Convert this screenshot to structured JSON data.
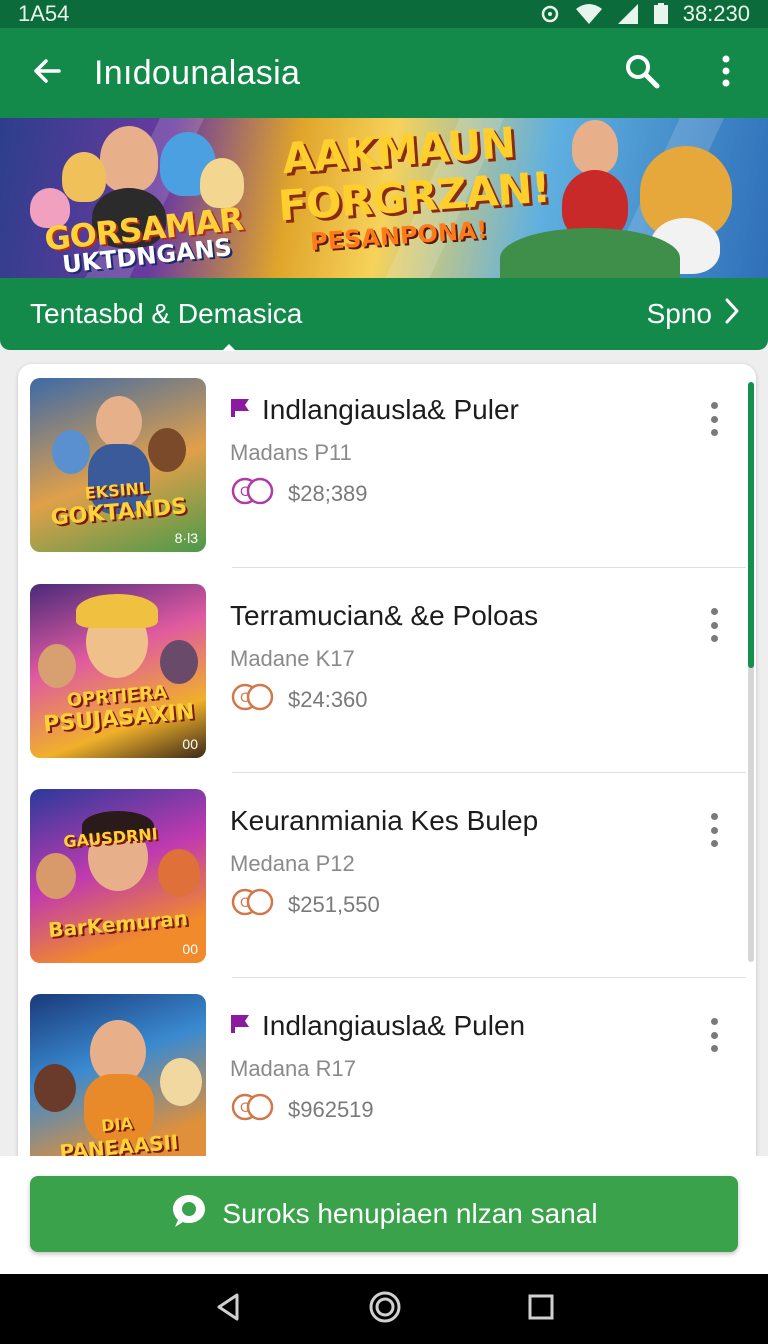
{
  "status_bar": {
    "left_text": "1A54",
    "time": "38:230"
  },
  "app_bar": {
    "title": "Inıdounalasia",
    "icons": [
      "back-arrow-icon",
      "search-icon",
      "more-vert-icon"
    ]
  },
  "banner": {
    "left_logo_line1": "GORSAMAR",
    "left_logo_line2": "UKTDNGANS",
    "headline_line1": "AAKMAUN",
    "headline_line2": "FORGRZAN!",
    "subline": "PESANPONA!"
  },
  "section": {
    "label": "Tentasbd & Demasica",
    "more_label": "Spno"
  },
  "items": [
    {
      "name": "Indlangiausla& Puler",
      "has_flag": true,
      "subtitle": "Madans P11",
      "price": "$28;389",
      "thumb_title_line1": "EKSINL",
      "thumb_title_line2": "GOKTANDS",
      "thumb_tag": "8·l3",
      "coin_color": "#b03aa8"
    },
    {
      "name": "Terramucian& &e Poloas",
      "has_flag": false,
      "subtitle": "Madane K17",
      "price": "$24:360",
      "thumb_title_line1": "OPRTIERA",
      "thumb_title_line2": "PSUJASAXIN",
      "thumb_tag": "00",
      "coin_color": "#d2774a"
    },
    {
      "name": "Keuranmiania Kes Bulep",
      "has_flag": false,
      "subtitle": "Medana P12",
      "price": "$251,550",
      "thumb_title_line1": "GAUSDRNI",
      "thumb_title_line2": "BarKemuran",
      "thumb_tag": "00",
      "coin_color": "#d2774a"
    },
    {
      "name": "Indlangiausla& Pulen",
      "has_flag": true,
      "subtitle": "Madana R17",
      "price": "$962519",
      "thumb_title_line1": "DIA",
      "thumb_title_line2": "PANEAASII",
      "thumb_tag": "",
      "coin_color": "#d2774a"
    }
  ],
  "cta": {
    "label": "Suroks henupiaen nlzan sanal",
    "icon": "chat-bubble-icon"
  },
  "nav": {
    "icons": [
      "back-triangle-icon",
      "home-circle-icon",
      "recents-square-icon"
    ]
  },
  "colors": {
    "app_bar": "#148a4a",
    "status_bar": "#0b6b3a",
    "cta": "#3aa24a",
    "flag": "#8a1aa0"
  }
}
